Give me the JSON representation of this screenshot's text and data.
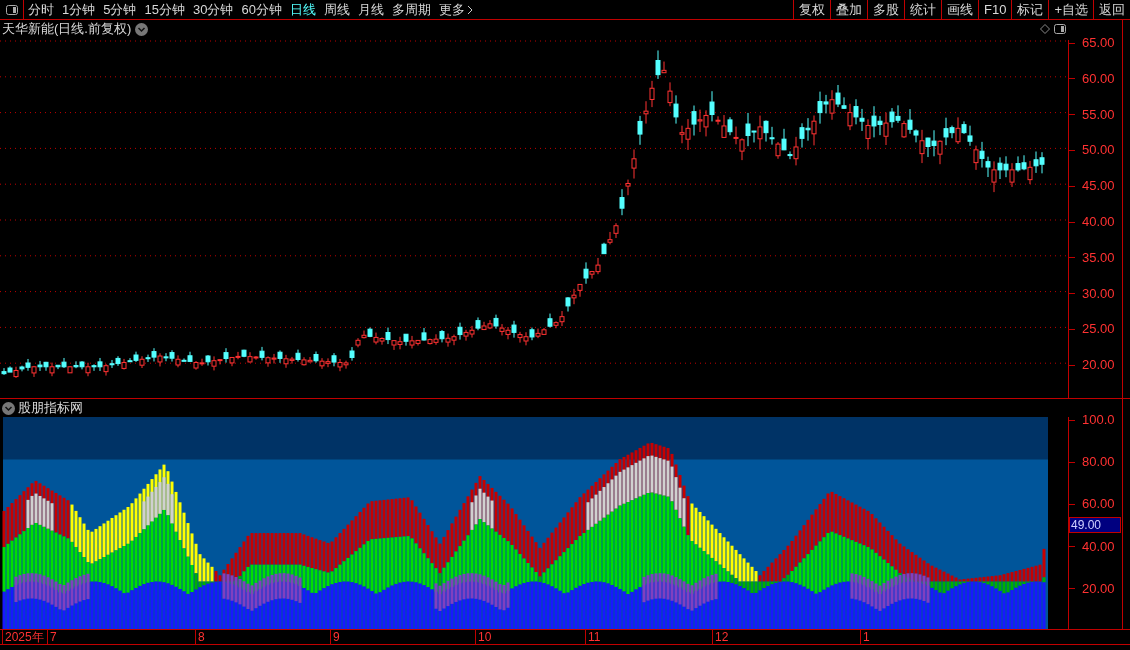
{
  "toolbar": {
    "periods": [
      {
        "label": "分时",
        "selected": false
      },
      {
        "label": "1分钟",
        "selected": false
      },
      {
        "label": "5分钟",
        "selected": false
      },
      {
        "label": "15分钟",
        "selected": false
      },
      {
        "label": "30分钟",
        "selected": false
      },
      {
        "label": "60分钟",
        "selected": false
      },
      {
        "label": "日线",
        "selected": true
      },
      {
        "label": "周线",
        "selected": false
      },
      {
        "label": "月线",
        "selected": false
      },
      {
        "label": "多周期",
        "selected": false
      },
      {
        "label": "更多",
        "selected": false
      }
    ],
    "actions": [
      "复权",
      "叠加",
      "多股",
      "统计",
      "画线",
      "F10",
      "标记",
      "+自选",
      "返回"
    ]
  },
  "price_panel": {
    "title": "天华新能(日线.前复权)",
    "yticks": [
      "65.00",
      "60.00",
      "55.00",
      "50.00",
      "45.00",
      "40.00",
      "35.00",
      "30.00",
      "25.00",
      "20.00"
    ]
  },
  "indicator_panel": {
    "title": "股朋指标网",
    "yticks": [
      "100.0",
      "80.00",
      "60.00",
      "40.00",
      "20.00"
    ],
    "cursor_value": "49.00"
  },
  "date_axis": [
    "2025年",
    "7",
    "8",
    "9",
    "10",
    "11",
    "12",
    "1"
  ]
}
